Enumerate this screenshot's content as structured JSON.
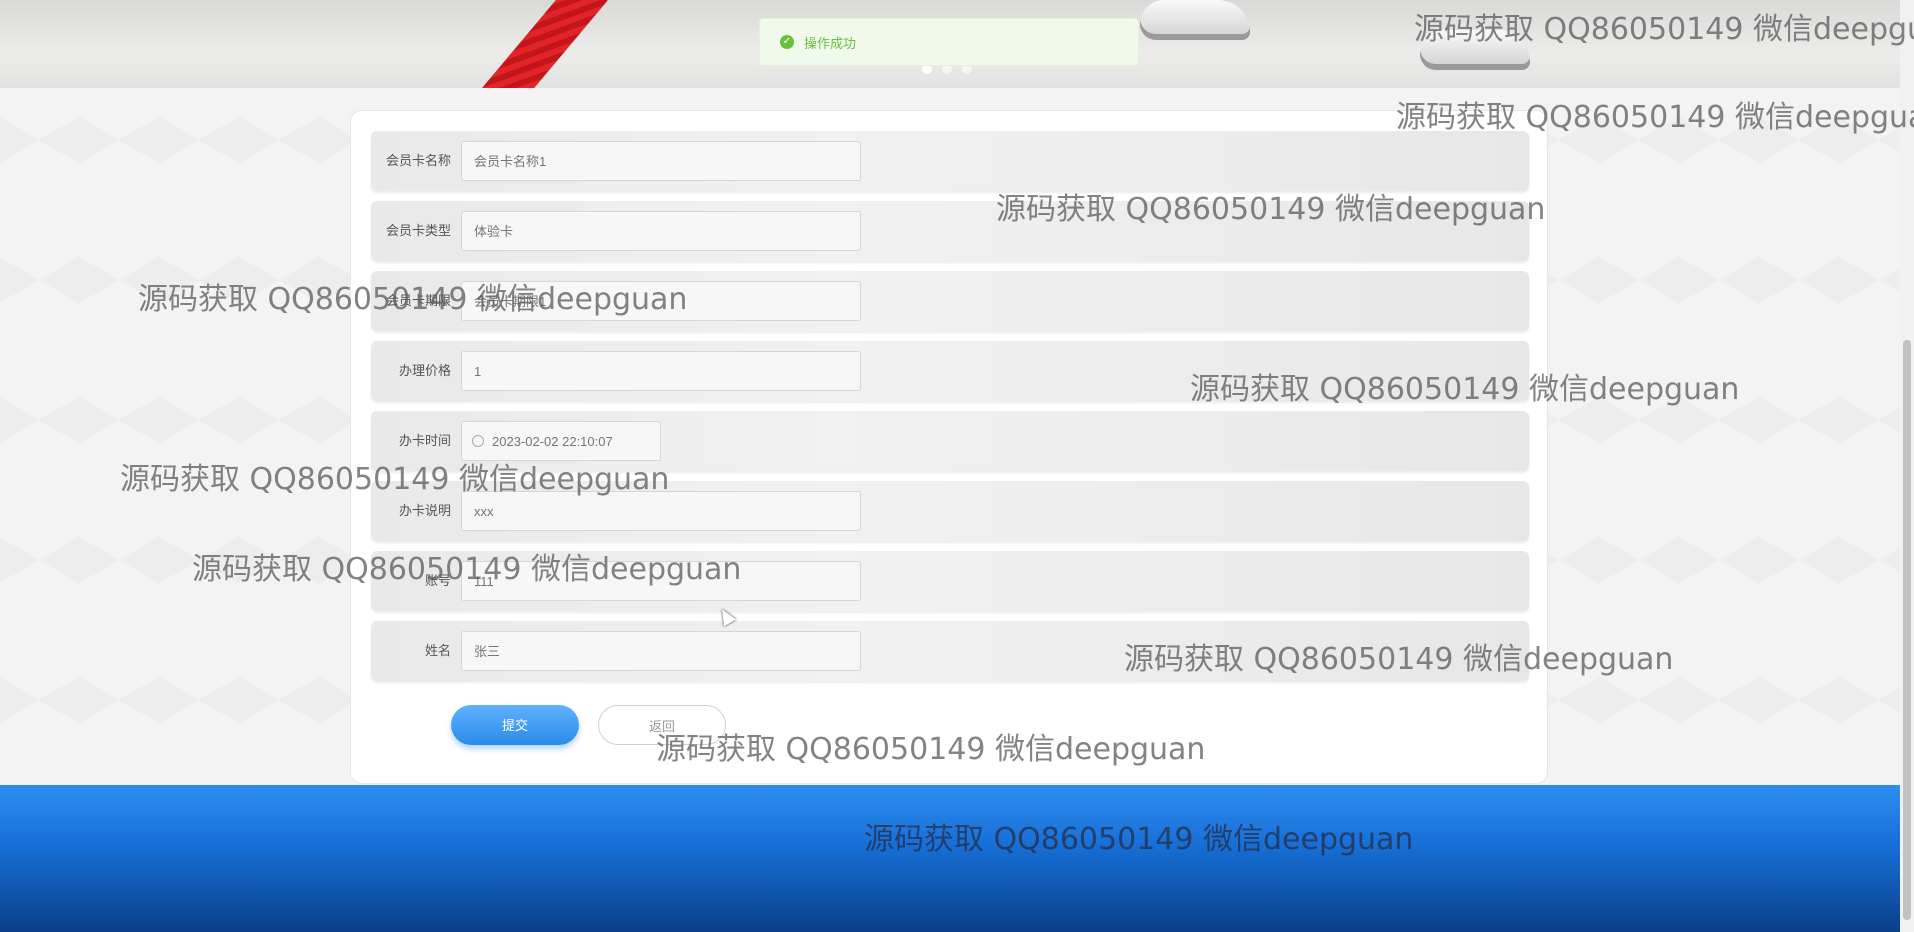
{
  "toast": {
    "message": "操作成功",
    "icon": "check-circle-icon"
  },
  "carousel": {
    "slides": 3,
    "active": 1
  },
  "form": {
    "fields": [
      {
        "label": "会员卡名称",
        "placeholder": "会员卡名称1"
      },
      {
        "label": "会员卡类型",
        "placeholder": "体验卡"
      },
      {
        "label": "会员卡期限",
        "placeholder": "会员卡期限1"
      },
      {
        "label": "办理价格",
        "placeholder": "1"
      },
      {
        "label": "办卡时间",
        "placeholder": "2023-02-02 22:10:07"
      },
      {
        "label": "办卡说明",
        "placeholder": "xxx"
      },
      {
        "label": "账号",
        "placeholder": "111"
      },
      {
        "label": "姓名",
        "placeholder": "张三"
      }
    ],
    "submit_label": "提交",
    "back_label": "返回"
  },
  "watermark": "源码获取 QQ86050149 微信deepguan",
  "colors": {
    "accent": "#2b8ae8",
    "success": "#67c23a",
    "footer": "#1770d8"
  }
}
